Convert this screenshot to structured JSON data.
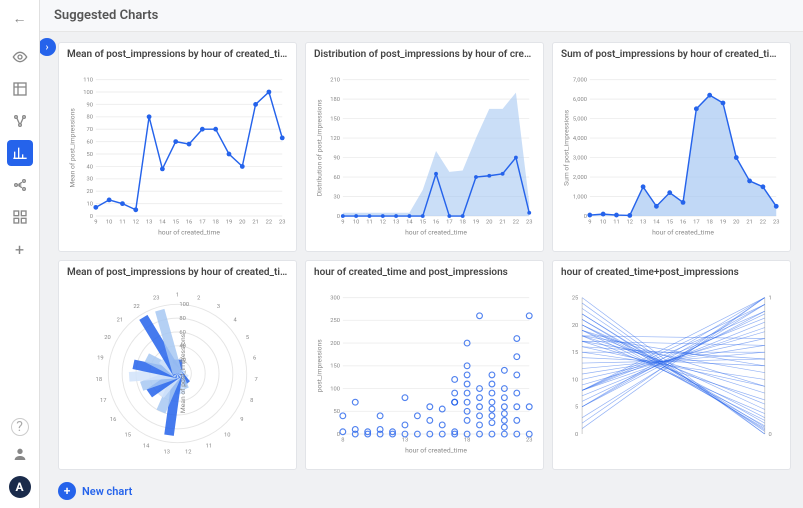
{
  "header": {
    "title": "Suggested Charts"
  },
  "sidebar": {
    "back_label": "←",
    "tools": [
      {
        "name": "view-icon"
      },
      {
        "name": "table-icon"
      },
      {
        "name": "graph-icon"
      },
      {
        "name": "bar-chart-icon",
        "active": true
      },
      {
        "name": "cluster-icon"
      },
      {
        "name": "layout-icon"
      }
    ],
    "add_label": "+",
    "help_label": "?",
    "user_label": "●",
    "badge_label": "A"
  },
  "footer": {
    "new_chart_label": "New chart"
  },
  "colors": {
    "primary": "#2563eb",
    "light": "#a7c8f2",
    "lighter": "#d1e3fa"
  },
  "cards": [
    {
      "title": "Mean of post_impressions by hour of created_time"
    },
    {
      "title": "Distribution of post_impressions by hour of created_t…"
    },
    {
      "title": "Sum of post_impressions by hour of created_time"
    },
    {
      "title": "Mean of post_impressions by hour of created_time"
    },
    {
      "title": "hour of created_time and post_impressions"
    },
    {
      "title": "hour of created_time+post_impressions"
    }
  ],
  "chart_data": [
    {
      "type": "line",
      "title": "Mean of post_impressions by hour of created_time",
      "xlabel": "hour of created_time",
      "ylabel": "Mean of post_impressions",
      "x": [
        9,
        10,
        11,
        12,
        13,
        14,
        15,
        16,
        17,
        18,
        19,
        20,
        21,
        22,
        23
      ],
      "y": [
        7,
        13,
        10,
        5,
        80,
        38,
        60,
        58,
        70,
        70,
        50,
        40,
        90,
        100,
        63
      ],
      "ylim": [
        0,
        110
      ],
      "yticks": [
        0,
        10,
        20,
        30,
        40,
        50,
        60,
        70,
        80,
        90,
        100,
        110
      ]
    },
    {
      "type": "area",
      "title": "Distribution of post_impressions by hour of created_time",
      "xlabel": "hour of created_time",
      "ylabel": "Distribution of post_impressions",
      "x": [
        9,
        10,
        11,
        12,
        13,
        14,
        15,
        16,
        17,
        18,
        19,
        20,
        21,
        22,
        23
      ],
      "median": [
        0,
        0,
        0,
        0,
        0,
        0,
        0,
        65,
        0,
        0,
        60,
        62,
        65,
        90,
        5
      ],
      "upper": [
        5,
        5,
        5,
        5,
        5,
        5,
        40,
        100,
        68,
        70,
        120,
        165,
        165,
        190,
        20
      ],
      "ylim": [
        0,
        210
      ],
      "yticks": [
        0,
        30,
        60,
        90,
        120,
        150,
        180,
        210
      ]
    },
    {
      "type": "area",
      "title": "Sum of post_impressions by hour of created_time",
      "xlabel": "hour of created_time",
      "ylabel": "Sum of post_impressions",
      "x": [
        9,
        10,
        11,
        12,
        13,
        14,
        15,
        16,
        17,
        18,
        19,
        20,
        21,
        22,
        23
      ],
      "y": [
        50,
        100,
        50,
        30,
        1500,
        500,
        1200,
        700,
        5500,
        6200,
        5800,
        3000,
        1800,
        1500,
        500
      ],
      "ylim": [
        0,
        7000
      ],
      "yticks": [
        0,
        1000,
        2000,
        3000,
        4000,
        5000,
        6000,
        7000
      ]
    },
    {
      "type": "polar-bar",
      "title": "Mean of post_impressions by hour of created_time",
      "axis_label": "Mean of post_impressions",
      "categories": [
        1,
        2,
        3,
        4,
        5,
        6,
        7,
        8,
        9,
        10,
        11,
        12,
        13,
        14,
        15,
        16,
        17,
        18,
        19,
        20,
        21,
        22,
        23
      ],
      "values": [
        20,
        5,
        5,
        5,
        5,
        5,
        5,
        10,
        15,
        20,
        25,
        30,
        90,
        60,
        40,
        50,
        55,
        70,
        65,
        50,
        30,
        95,
        95
      ],
      "rlim": 100,
      "rticks": [
        20,
        40,
        60,
        80,
        100
      ]
    },
    {
      "type": "scatter",
      "title": "hour of created_time and post_impressions",
      "xlabel": "hour of created_time",
      "ylabel": "post_impressions",
      "xlim": [
        8,
        23
      ],
      "ylim": [
        0,
        300
      ],
      "yticks": [
        0,
        50,
        100,
        150,
        200,
        250,
        300
      ],
      "xticks": [
        8,
        13,
        18,
        23
      ],
      "points": [
        [
          8,
          40
        ],
        [
          8,
          5
        ],
        [
          9,
          0
        ],
        [
          9,
          70
        ],
        [
          9,
          10
        ],
        [
          10,
          0
        ],
        [
          10,
          5
        ],
        [
          11,
          0
        ],
        [
          11,
          10
        ],
        [
          11,
          40
        ],
        [
          12,
          0
        ],
        [
          12,
          5
        ],
        [
          13,
          0
        ],
        [
          13,
          80
        ],
        [
          13,
          20
        ],
        [
          14,
          0
        ],
        [
          14,
          40
        ],
        [
          15,
          0
        ],
        [
          15,
          60
        ],
        [
          15,
          30
        ],
        [
          16,
          0
        ],
        [
          16,
          55
        ],
        [
          16,
          20
        ],
        [
          17,
          0
        ],
        [
          17,
          5
        ],
        [
          17,
          70
        ],
        [
          17,
          70
        ],
        [
          17,
          70
        ],
        [
          17,
          90
        ],
        [
          17,
          120
        ],
        [
          18,
          0
        ],
        [
          18,
          30
        ],
        [
          18,
          50
        ],
        [
          18,
          70
        ],
        [
          18,
          90
        ],
        [
          18,
          110
        ],
        [
          18,
          130
        ],
        [
          18,
          150
        ],
        [
          18,
          200
        ],
        [
          19,
          0
        ],
        [
          19,
          20
        ],
        [
          19,
          40
        ],
        [
          19,
          60
        ],
        [
          19,
          80
        ],
        [
          19,
          100
        ],
        [
          19,
          260
        ],
        [
          20,
          0
        ],
        [
          20,
          25
        ],
        [
          20,
          40
        ],
        [
          20,
          55
        ],
        [
          20,
          70
        ],
        [
          20,
          90
        ],
        [
          20,
          110
        ],
        [
          20,
          130
        ],
        [
          21,
          0
        ],
        [
          21,
          15
        ],
        [
          21,
          30
        ],
        [
          21,
          45
        ],
        [
          21,
          60
        ],
        [
          21,
          80
        ],
        [
          21,
          100
        ],
        [
          21,
          140
        ],
        [
          22,
          0
        ],
        [
          22,
          30
        ],
        [
          22,
          60
        ],
        [
          22,
          90
        ],
        [
          22,
          130
        ],
        [
          22,
          170
        ],
        [
          22,
          210
        ],
        [
          23,
          0
        ],
        [
          23,
          60
        ],
        [
          23,
          260
        ]
      ]
    },
    {
      "type": "parallel",
      "title": "hour of created_time+post_impressions",
      "left_range": [
        0,
        25
      ],
      "right_range": [
        0,
        1
      ],
      "left_ticks": [
        0,
        5,
        10,
        15,
        20,
        25
      ],
      "right_ticks": [
        0,
        1
      ],
      "lines": [
        [
          25,
          0.0
        ],
        [
          24,
          0.0
        ],
        [
          23,
          0.02
        ],
        [
          22,
          0.03
        ],
        [
          22,
          0.05
        ],
        [
          21,
          0.04
        ],
        [
          21,
          0.08
        ],
        [
          20,
          0.06
        ],
        [
          20,
          0.12
        ],
        [
          20,
          0.18
        ],
        [
          19,
          0.1
        ],
        [
          19,
          0.22
        ],
        [
          19,
          0.35
        ],
        [
          18,
          0.15
        ],
        [
          18,
          0.3
        ],
        [
          18,
          0.5
        ],
        [
          18,
          0.7
        ],
        [
          17,
          0.25
        ],
        [
          17,
          0.45
        ],
        [
          17,
          0.65
        ],
        [
          16,
          0.35
        ],
        [
          16,
          0.55
        ],
        [
          15,
          0.4
        ],
        [
          15,
          0.6
        ],
        [
          14,
          0.5
        ],
        [
          13,
          0.55
        ],
        [
          12,
          0.6
        ],
        [
          11,
          0.65
        ],
        [
          10,
          0.7
        ],
        [
          9,
          0.75
        ],
        [
          8,
          0.78
        ],
        [
          8,
          0.85
        ],
        [
          8,
          0.9
        ],
        [
          8,
          0.95
        ],
        [
          8,
          1.0
        ],
        [
          7,
          0.82
        ],
        [
          6,
          0.88
        ],
        [
          5,
          0.9
        ],
        [
          5,
          0.95
        ],
        [
          5,
          1.0
        ],
        [
          3,
          0.95
        ],
        [
          2,
          1.0
        ],
        [
          1,
          1.0
        ]
      ]
    }
  ]
}
